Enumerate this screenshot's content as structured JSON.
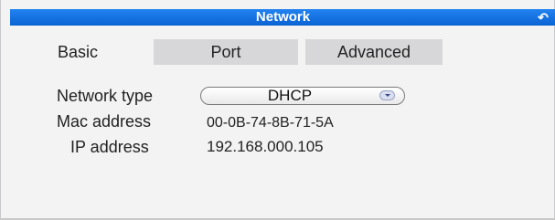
{
  "window": {
    "title": "Network",
    "back_icon": "undo-arrow-icon"
  },
  "tabs": [
    {
      "label": "Basic",
      "selected": true
    },
    {
      "label": "Port",
      "selected": false
    },
    {
      "label": "Advanced",
      "selected": false
    }
  ],
  "fields": {
    "network_type": {
      "label": "Network type",
      "value": "DHCP"
    },
    "mac_address": {
      "label": "Mac address",
      "value": "00-0B-74-8B-71-5A"
    },
    "ip_address": {
      "label": "IP address",
      "value": "192.168.000.105"
    }
  },
  "colors": {
    "title_bar": "#0f6fe0",
    "tab_inactive": "#d7d7d9",
    "background": "#f3f3f3"
  }
}
